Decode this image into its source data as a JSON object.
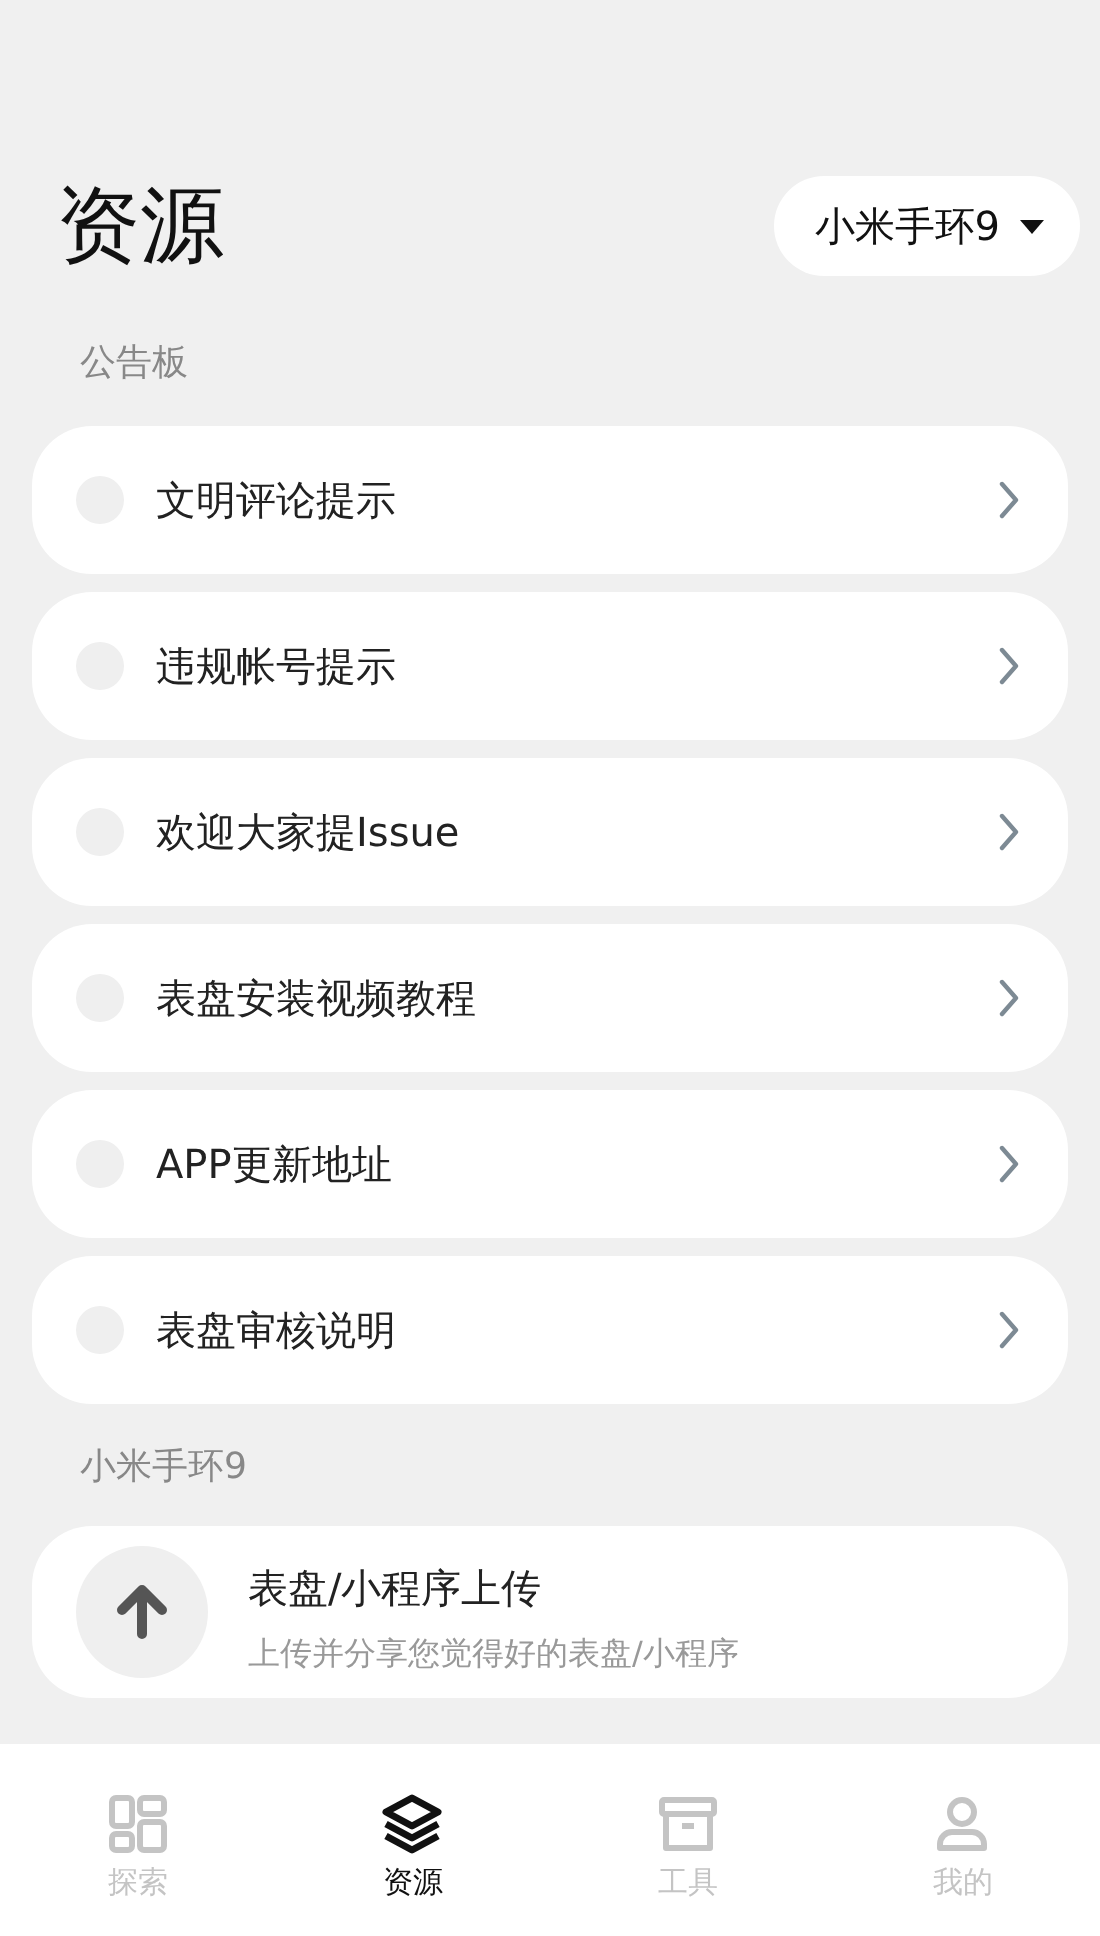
{
  "header": {
    "title": "资源",
    "device_selector": "小米手环9"
  },
  "notice_board": {
    "heading": "公告板",
    "items": [
      {
        "label": "文明评论提示"
      },
      {
        "label": "违规帐号提示"
      },
      {
        "label": "欢迎大家提Issue"
      },
      {
        "label": "表盘安装视频教程"
      },
      {
        "label": "APP更新地址"
      },
      {
        "label": "表盘审核说明"
      }
    ]
  },
  "device_section": {
    "heading": "小米手环9",
    "cards": [
      {
        "title": "表盘/小程序上传",
        "subtitle": "上传并分享您觉得好的表盘/小程序"
      }
    ]
  },
  "bottom_nav": [
    {
      "label": "探索",
      "selected": false
    },
    {
      "label": "资源",
      "selected": true
    },
    {
      "label": "工具",
      "selected": false
    },
    {
      "label": "我的",
      "selected": false
    }
  ]
}
